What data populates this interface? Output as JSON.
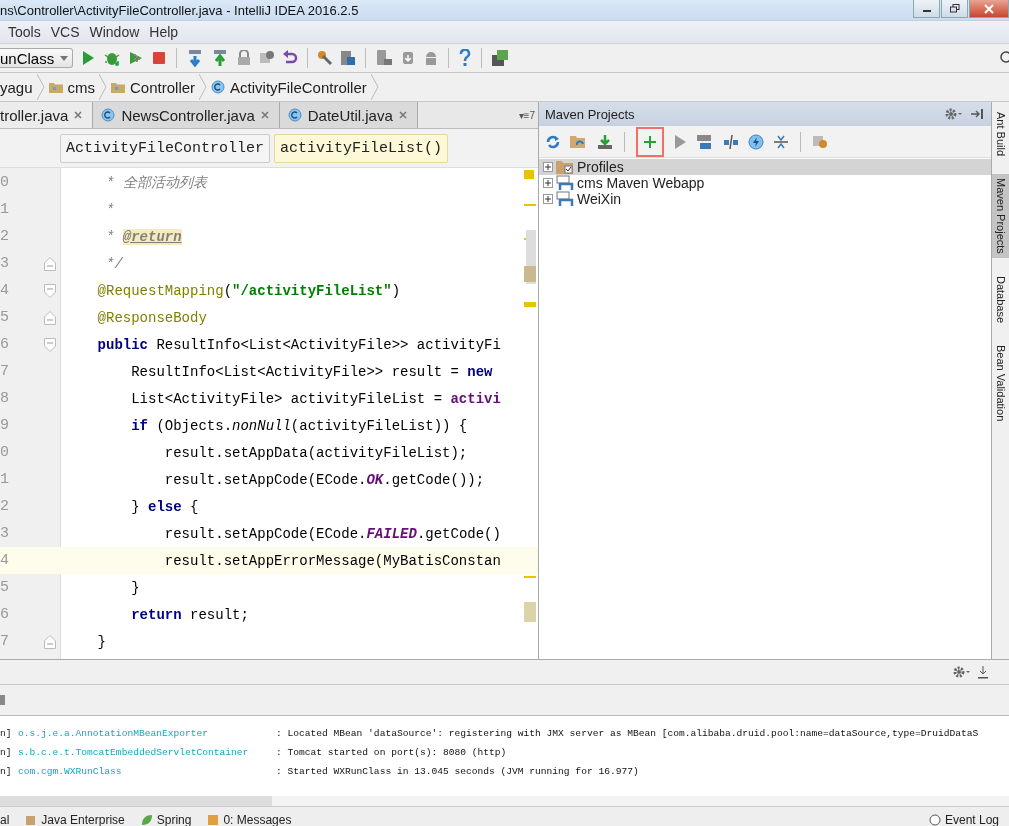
{
  "window": {
    "title": "ns\\Controller\\ActivityFileController.java - IntelliJ IDEA 2016.2.5"
  },
  "menu": [
    "Tools",
    "VCS",
    "Window",
    "Help"
  ],
  "toolbar": {
    "run_config": "unClass"
  },
  "breadcrumb": [
    "yagu",
    "cms",
    "Controller",
    "ActivityFileController"
  ],
  "editor_tabs": [
    {
      "label": "troller.java",
      "selected": true
    },
    {
      "label": "NewsController.java",
      "selected": false
    },
    {
      "label": "DateUtil.java",
      "selected": false
    }
  ],
  "tab_count": "▾≡7",
  "structure_path": [
    {
      "label": "ActivityFileController",
      "selected": false
    },
    {
      "label": "activityFileList()",
      "selected": true
    }
  ],
  "code": [
    {
      "number": "0",
      "current": false,
      "tokens": [
        {
          "kind": "comment",
          "text": "     * 全部活动列表"
        }
      ]
    },
    {
      "number": "1",
      "current": false,
      "tokens": [
        {
          "kind": "comment",
          "text": "     *"
        }
      ]
    },
    {
      "number": "2",
      "current": false,
      "tokens": [
        {
          "kind": "comment",
          "text": "     * "
        },
        {
          "kind": "doctag",
          "text": "@return"
        }
      ]
    },
    {
      "number": "3",
      "current": false,
      "kind": "fold_end",
      "tokens": [
        {
          "kind": "comment",
          "text": "     */"
        }
      ]
    },
    {
      "number": "4",
      "current": false,
      "kind": "fold_start",
      "tokens": [
        {
          "kind": "annotation",
          "text": "    @RequestMapping"
        },
        {
          "kind": "plain",
          "text": "("
        },
        {
          "kind": "string",
          "text": "\"/activityFileList\""
        },
        {
          "kind": "plain",
          "text": ")"
        }
      ]
    },
    {
      "number": "5",
      "current": false,
      "kind": "fold_end",
      "tokens": [
        {
          "kind": "annotation",
          "text": "    @ResponseBody"
        }
      ]
    },
    {
      "number": "6",
      "current": false,
      "kind": "fold_start",
      "tokens": [
        {
          "kind": "keyword",
          "text": "    public"
        },
        {
          "kind": "plain",
          "text": " ResultInfo<List<ActivityFile>> activityFi"
        }
      ]
    },
    {
      "number": "7",
      "current": false,
      "tokens": [
        {
          "kind": "plain",
          "text": "        ResultInfo<List<ActivityFile>> result = "
        },
        {
          "kind": "keyword",
          "text": "new"
        }
      ]
    },
    {
      "number": "8",
      "current": false,
      "tokens": [
        {
          "kind": "plain",
          "text": "        List<ActivityFile> activityFileList = "
        },
        {
          "kind": "field",
          "text": "activi"
        }
      ]
    },
    {
      "number": "9",
      "current": false,
      "tokens": [
        {
          "kind": "keyword",
          "text": "        if"
        },
        {
          "kind": "plain",
          "text": " (Objects."
        },
        {
          "kind": "static",
          "text": "nonNull"
        },
        {
          "kind": "plain",
          "text": "(activityFileList)) {"
        }
      ]
    },
    {
      "number": "0",
      "current": false,
      "tokens": [
        {
          "kind": "plain",
          "text": "            result.setAppData(activityFileList);"
        }
      ]
    },
    {
      "number": "1",
      "current": false,
      "tokens": [
        {
          "kind": "plain",
          "text": "            result.setAppCode(ECode."
        },
        {
          "kind": "constant",
          "text": "OK"
        },
        {
          "kind": "plain",
          "text": ".getCode());"
        }
      ]
    },
    {
      "number": "2",
      "current": false,
      "tokens": [
        {
          "kind": "plain",
          "text": "        } "
        },
        {
          "kind": "keyword",
          "text": "else"
        },
        {
          "kind": "plain",
          "text": " {"
        }
      ]
    },
    {
      "number": "3",
      "current": false,
      "tokens": [
        {
          "kind": "plain",
          "text": "            result.setAppCode(ECode."
        },
        {
          "kind": "constant",
          "text": "FAILED"
        },
        {
          "kind": "plain",
          "text": ".getCode()"
        }
      ]
    },
    {
      "number": "4",
      "current": true,
      "tokens": [
        {
          "kind": "plain",
          "text": "            result.setAppErrorMessage(MyBatisConstan"
        }
      ]
    },
    {
      "number": "5",
      "current": false,
      "tokens": [
        {
          "kind": "plain",
          "text": "        }"
        }
      ]
    },
    {
      "number": "6",
      "current": false,
      "tokens": [
        {
          "kind": "keyword",
          "text": "        return"
        },
        {
          "kind": "plain",
          "text": " result;"
        }
      ]
    },
    {
      "number": "7",
      "current": false,
      "kind": "fold_end",
      "tokens": [
        {
          "kind": "plain",
          "text": "    }"
        }
      ]
    }
  ],
  "maven": {
    "title": "Maven Projects",
    "add_button_highlighted": true,
    "tree": [
      {
        "label": "Profiles",
        "kind": "profiles",
        "selected": true
      },
      {
        "label": "cms Maven Webapp",
        "kind": "project",
        "selected": false
      },
      {
        "label": "WeiXin",
        "kind": "project",
        "selected": false
      }
    ]
  },
  "side_tools": [
    {
      "label": "Ant Build",
      "selected": false
    },
    {
      "label": "Maven Projects",
      "selected": true
    },
    {
      "label": "Database",
      "selected": false
    },
    {
      "label": "Bean Validation",
      "selected": false
    }
  ],
  "console": [
    {
      "prefix": "n]",
      "logger": "o.s.j.e.a.AnnotationMBeanExporter",
      "message": ": Located MBean 'dataSource': registering with JMX server as MBean [com.alibaba.druid.pool:name=dataSource,type=DruidDataS"
    },
    {
      "prefix": "n]",
      "logger": "s.b.c.e.t.TomcatEmbeddedServletContainer",
      "message": ": Tomcat started on port(s): 8080 (http)"
    },
    {
      "prefix": "n]",
      "logger": "com.cgm.WXRunClass",
      "message": ": Started WXRunClass in 13.045 seconds (JVM running for 16.977)"
    }
  ],
  "bottom_tools": [
    {
      "label": "al",
      "kind": "plain"
    },
    {
      "label": "Java Enterprise",
      "kind": "javaee"
    },
    {
      "label": "Spring",
      "kind": "spring"
    },
    {
      "label": "0: Messages",
      "kind": "messages"
    }
  ],
  "event_log": "Event Log"
}
